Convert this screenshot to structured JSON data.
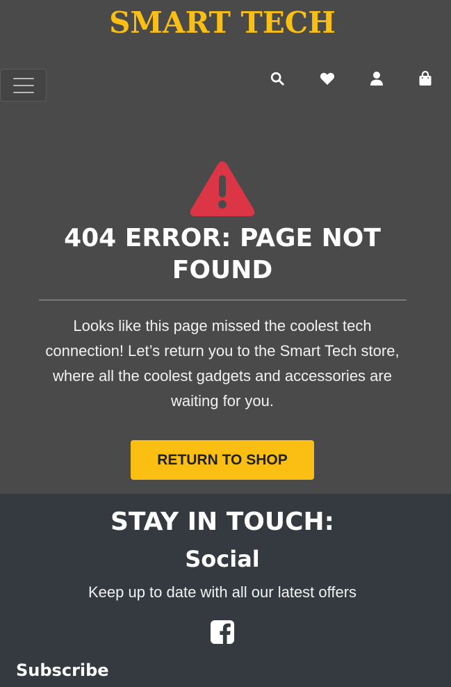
{
  "header": {
    "brand": "SMART TECH",
    "icons": [
      "hamburger-icon",
      "search-icon",
      "heart-icon",
      "user-icon",
      "shopping-bag-icon"
    ]
  },
  "main": {
    "icon": "warning-triangle-icon",
    "title": "404 ERROR: PAGE NOT FOUND",
    "message": "Looks like this page missed the coolest tech connection! Let’s return you to the Smart Tech store, where all the coolest gadgets and accessories are waiting for you.",
    "button_label": "RETURN TO SHOP"
  },
  "footer": {
    "heading": "STAY IN TOUCH:",
    "social_heading": "Social",
    "social_text": "Keep up to date with all our latest offers",
    "social_icon": "facebook-icon",
    "subscribe_heading": "Subscribe"
  },
  "colors": {
    "brand": "#fbbf13",
    "background": "#4a4a4a",
    "footer": "#343a40",
    "warning": "#dc3545",
    "divider": "#b9b21b"
  }
}
